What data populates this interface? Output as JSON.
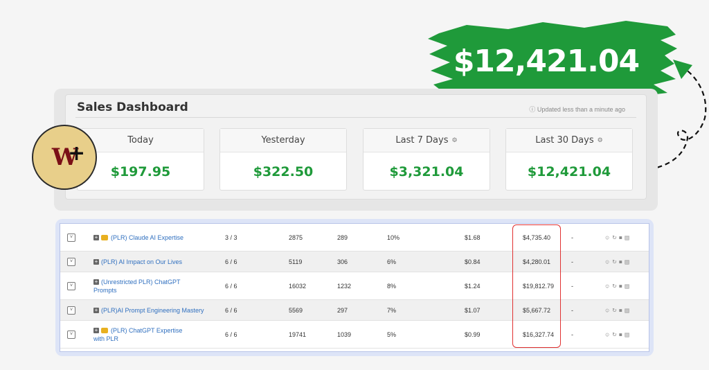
{
  "banner": {
    "amount": "$12,421.04"
  },
  "dashboard": {
    "title": "Sales Dashboard",
    "updated": "ⓘ Updated less than a minute ago",
    "cards": [
      {
        "label": "Today",
        "value": "$197.95",
        "has_gear": false
      },
      {
        "label": "Yesterday",
        "value": "$322.50",
        "has_gear": false
      },
      {
        "label": "Last 7 Days",
        "value": "$3,321.04",
        "has_gear": true
      },
      {
        "label": "Last 30 Days",
        "value": "$12,421.04",
        "has_gear": true
      }
    ]
  },
  "logo": {
    "text": "W",
    "plus": "+"
  },
  "products": [
    {
      "name": "(PLR) Claude AI Expertise",
      "name2": "",
      "trophy": true,
      "ratio": "3 / 3",
      "views": "2875",
      "clicks": "289",
      "rate": "10%",
      "epc": "$1.68",
      "sales": "$4,735.40",
      "dash": "-"
    },
    {
      "name": "(PLR) AI Impact on Our Lives",
      "name2": "",
      "trophy": false,
      "ratio": "6 / 6",
      "views": "5119",
      "clicks": "306",
      "rate": "6%",
      "epc": "$0.84",
      "sales": "$4,280.01",
      "dash": "-"
    },
    {
      "name": "(Unrestricted PLR) ChatGPT",
      "name2": "Prompts",
      "trophy": false,
      "ratio": "6 / 6",
      "views": "16032",
      "clicks": "1232",
      "rate": "8%",
      "epc": "$1.24",
      "sales": "$19,812.79",
      "dash": "-"
    },
    {
      "name": "(PLR)AI Prompt Engineering Mastery",
      "name2": "",
      "trophy": false,
      "ratio": "6 / 6",
      "views": "5569",
      "clicks": "297",
      "rate": "7%",
      "epc": "$1.07",
      "sales": "$5,667.72",
      "dash": "-"
    },
    {
      "name": "(PLR) ChatGPT Expertise",
      "name2": "with PLR",
      "trophy": true,
      "ratio": "6 / 6",
      "views": "19741",
      "clicks": "1039",
      "rate": "5%",
      "epc": "$0.99",
      "sales": "$16,327.74",
      "dash": "-"
    }
  ],
  "colors": {
    "accent_green": "#1f9a3a",
    "banner_green": "#1f9a3a",
    "highlight_red": "#e03030"
  }
}
